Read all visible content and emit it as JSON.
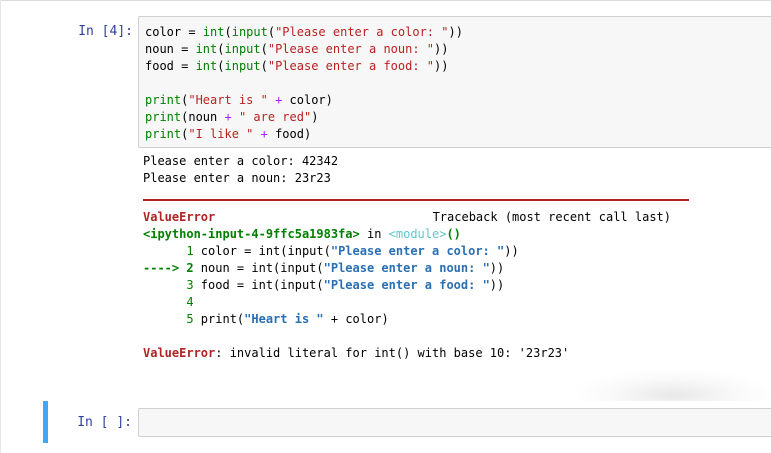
{
  "cell1": {
    "prompt": "In  [4]:",
    "code": {
      "l1": {
        "a": "color = ",
        "b": "int",
        "c": "(",
        "d": "input",
        "e": "(",
        "f": "\"Please enter a color: \"",
        "g": "))"
      },
      "l2": {
        "a": "noun = ",
        "b": "int",
        "c": "(",
        "d": "input",
        "e": "(",
        "f": "\"Please enter a noun: \"",
        "g": "))"
      },
      "l3": {
        "a": "food = ",
        "b": "int",
        "c": "(",
        "d": "input",
        "e": "(",
        "f": "\"Please enter a food: \"",
        "g": "))"
      },
      "l5": {
        "a": "print",
        "b": "(",
        "c": "\"Heart is \"",
        "d": " + ",
        "e": "color",
        "f": ")"
      },
      "l6": {
        "a": "print",
        "b": "(noun ",
        "c": "+",
        "d": " \" are red\"",
        "e": ")"
      },
      "l7": {
        "a": "print",
        "b": "(",
        "c": "\"I like \"",
        "d": " + ",
        "e": "food",
        "f": ")"
      }
    },
    "output": {
      "stdin1": "Please enter a color: 42342",
      "stdin2": "Please enter a noun: 23r23",
      "error_type": "ValueError",
      "traceback_label": "Traceback (most recent call last)",
      "location_file": "<ipython-input-4-9ffc5a1983fa>",
      "location_in": " in ",
      "location_module": "<module>",
      "location_parens": "()",
      "tb1": {
        "no": "      1 ",
        "a": "color = int(input(",
        "s": "\"Please enter a color: \"",
        "b": "))"
      },
      "tb2": {
        "arrow": "----> 2 ",
        "a": "noun = int(input(",
        "s": "\"Please enter a noun: \"",
        "b": "))"
      },
      "tb3": {
        "no": "      3 ",
        "a": "food = int(input(",
        "s": "\"Please enter a food: \"",
        "b": "))"
      },
      "tb4": {
        "no": "      4"
      },
      "tb5": {
        "no": "      5 ",
        "a": "print(",
        "s": "\"Heart is \"",
        "b": " + color)"
      },
      "final_name": "ValueError",
      "final_msg": ": invalid literal for int() with base 10: '23r23'"
    }
  },
  "cell2": {
    "prompt": "In  [ ]:",
    "value": ""
  },
  "colors": {
    "prompt": "#303f9f",
    "builtin": "#008000",
    "string": "#ba2121",
    "operator": "#aa22ff",
    "error": "#b22222",
    "selected_cell": "#42a5f5"
  }
}
